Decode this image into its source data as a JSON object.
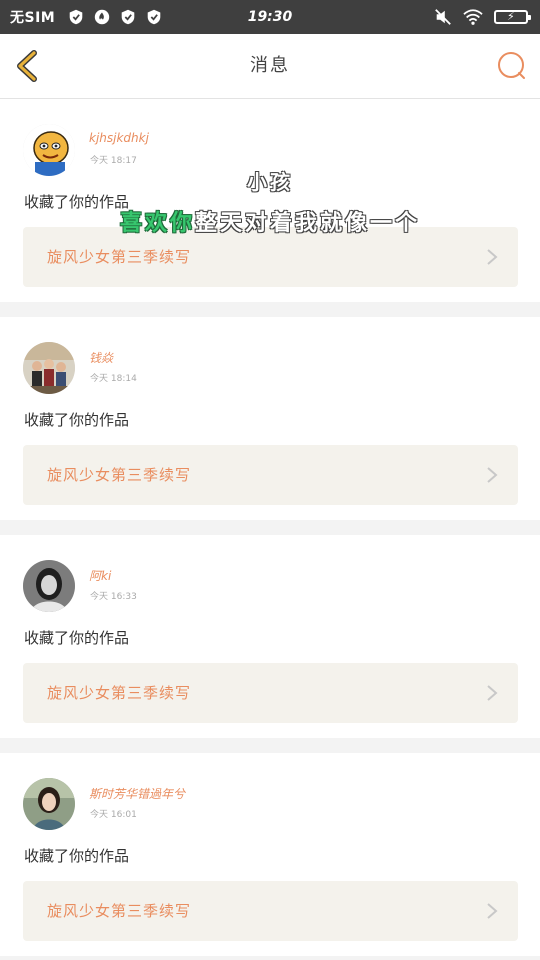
{
  "status_bar": {
    "carrier": "无SIM",
    "time": "19:30",
    "icons": [
      "shield-icon",
      "shield-fire-icon",
      "shield-icon",
      "shield-icon",
      "mute-icon",
      "wifi-icon",
      "battery-charging-icon"
    ]
  },
  "header": {
    "title": "消息",
    "back_icon": "chevron-left-icon",
    "search_icon": "search-icon"
  },
  "notifications": [
    {
      "username": "kjhsjkdhkj",
      "time": "今天 18:17",
      "action": "收藏了你的作品",
      "work_title": "旋风少女第三季续写",
      "avatar": "cartoon-avatar"
    },
    {
      "username": "钱焱",
      "time": "今天 18:14",
      "action": "收藏了你的作品",
      "work_title": "旋风少女第三季续写",
      "avatar": "family-photo-avatar"
    },
    {
      "username": "阿ki",
      "time": "今天 16:33",
      "action": "收藏了你的作品",
      "work_title": "旋风少女第三季续写",
      "avatar": "portrait-avatar"
    },
    {
      "username": "斯时芳华错過年兮",
      "time": "今天 16:01",
      "action": "收藏了你的作品",
      "work_title": "旋风少女第三季续写",
      "avatar": "girl-photo-avatar"
    }
  ],
  "lyrics_overlay": {
    "line1": "小孩",
    "line2_highlight": "喜欢你",
    "line2_rest": "整天对着我就像一个"
  },
  "colors": {
    "accent": "#e98d5f",
    "back_icon": "#e8b23a",
    "status_bar_bg": "#3f3f3f",
    "lyric_highlight": "#37c66e"
  }
}
